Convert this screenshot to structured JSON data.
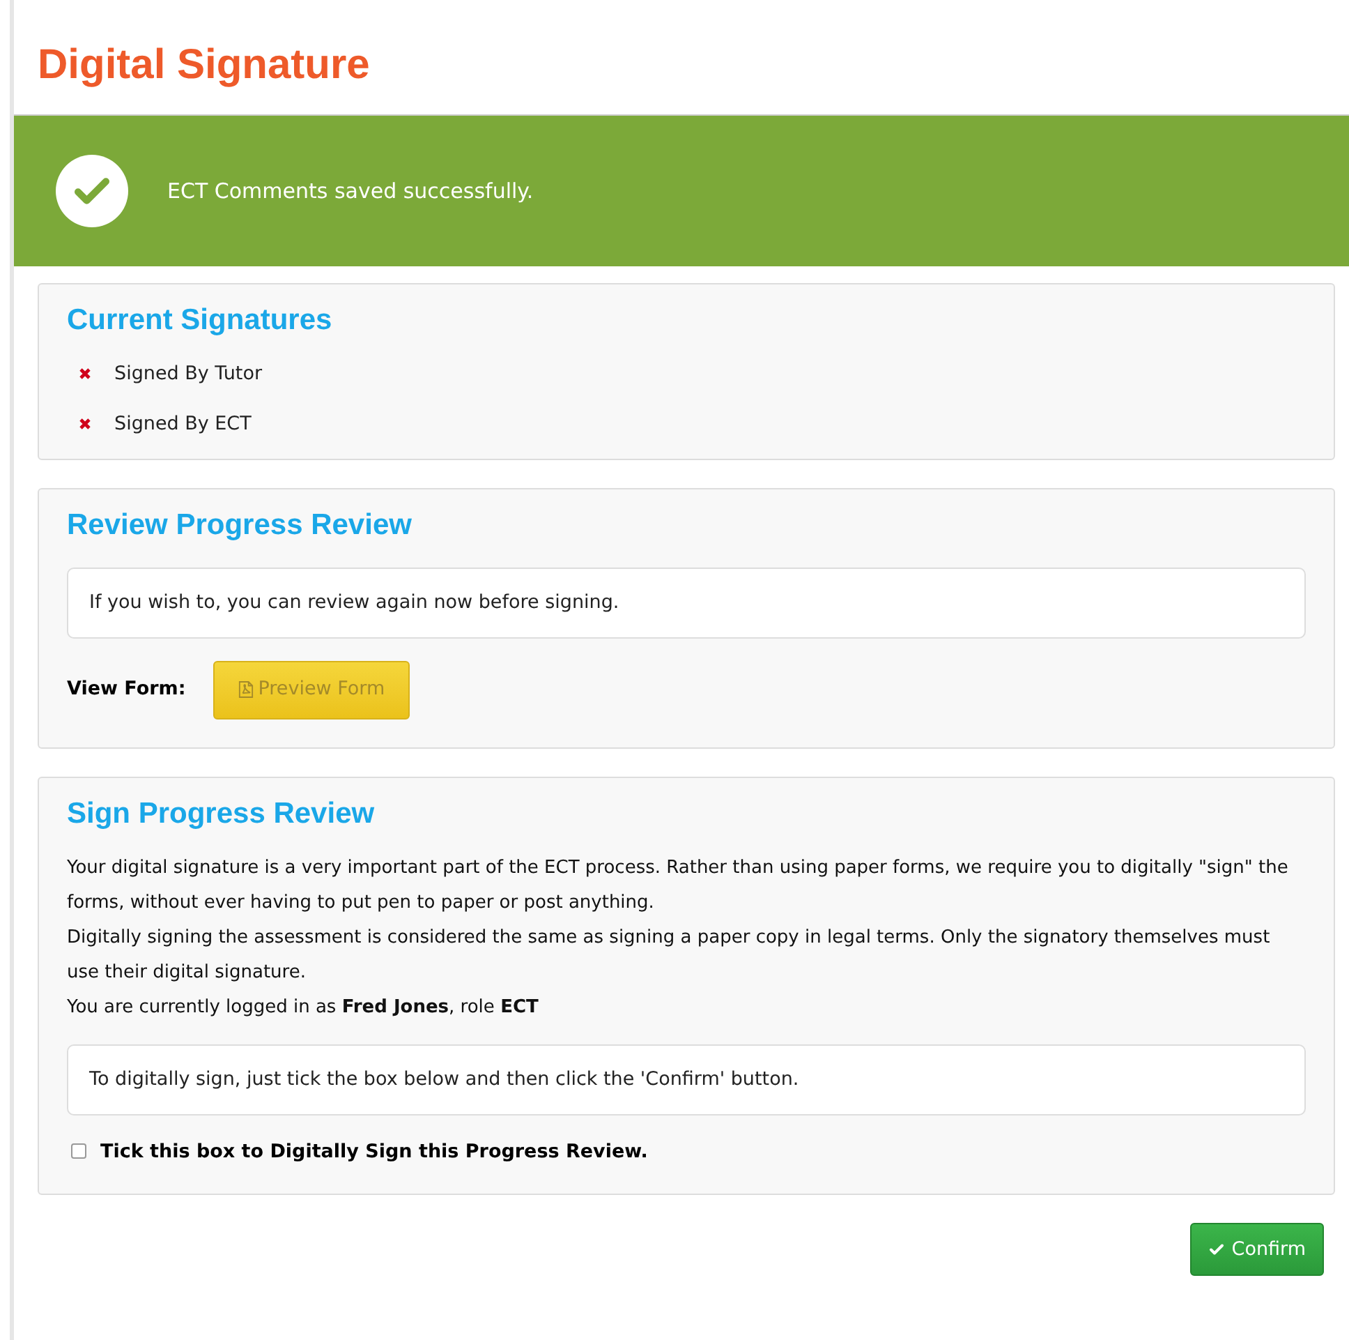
{
  "page_title": "Digital Signature",
  "alert": {
    "kind": "success",
    "message": "ECT Comments saved successfully."
  },
  "current_signatures": {
    "title": "Current Signatures",
    "items": [
      {
        "label": "Signed By Tutor",
        "signed": false
      },
      {
        "label": "Signed By ECT",
        "signed": false
      }
    ]
  },
  "review": {
    "title": "Review Progress Review",
    "note": "If you wish to, you can review again now before signing.",
    "view_label": "View Form:",
    "preview_button": "Preview Form"
  },
  "sign": {
    "title": "Sign Progress Review",
    "paragraphs": [
      "Your digital signature is a very important part of the ECT process. Rather than using paper forms, we require you to digitally \"sign\" the forms, without ever having to put pen to paper or post anything.",
      "Digitally signing the assessment is considered the same as signing a paper copy in legal terms. Only the signatory themselves must use their digital signature.",
      "You are currently logged in as **Fred Jones**, role **ECT**"
    ],
    "note": "To digitally sign, just tick the box below and then click the 'Confirm' button.",
    "checkbox": {
      "label": "Tick this box to Digitally Sign this Progress Review.",
      "checked": false
    }
  },
  "confirm_button": "Confirm"
}
